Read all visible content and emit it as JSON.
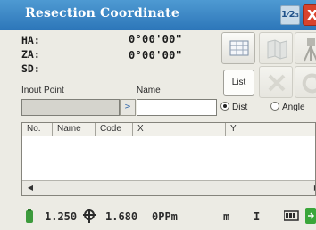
{
  "window": {
    "title": "Resection Coordinate",
    "keyboard_icon": "1⁄2₃",
    "close_label": "X"
  },
  "angles": [
    {
      "label": "HA:",
      "value": "0°00'00\""
    },
    {
      "label": "ZA:",
      "value": "0°00'00\""
    },
    {
      "label": "SD:",
      "value": ""
    }
  ],
  "input_point": {
    "label": "Inout Point",
    "name_label": "Name",
    "arrow": ">"
  },
  "buttons": {
    "list": "List",
    "icon_names": [
      "table-icon",
      "map-icon",
      "survey-icon",
      "delete-icon",
      "refresh-icon"
    ]
  },
  "mode": {
    "options": [
      {
        "label": "Dist",
        "selected": true
      },
      {
        "label": "Angle",
        "selected": false
      }
    ]
  },
  "table": {
    "columns": [
      "No.",
      "Name",
      "Code",
      "X",
      "Y"
    ]
  },
  "status": {
    "prism_constant": "1.250",
    "target_height": "1.680",
    "ppm": "0PPm",
    "unit": "m",
    "instrument_mark": "I"
  }
}
